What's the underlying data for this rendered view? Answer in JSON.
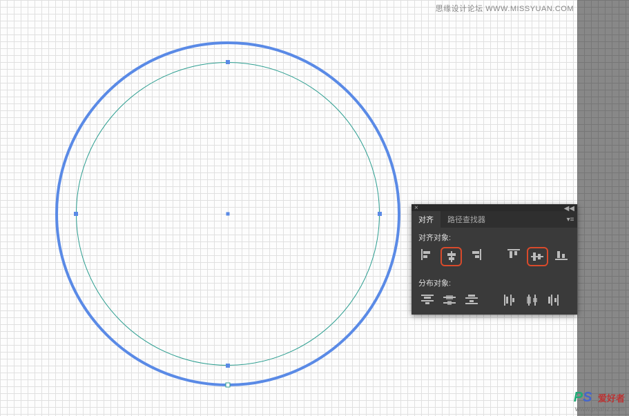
{
  "watermarks": {
    "top": "思缘设计论坛  WWW.MISSYUAN.COM",
    "bottom_logo_p": "P",
    "bottom_logo_s": "S",
    "bottom_cn": "爱好者",
    "bottom_url": "www.psahz.com"
  },
  "panel": {
    "tabs": {
      "align": "对齐",
      "pathfinder": "路径查找器"
    },
    "sections": {
      "align_objects": "对齐对象:",
      "distribute_objects": "分布对象:"
    }
  }
}
